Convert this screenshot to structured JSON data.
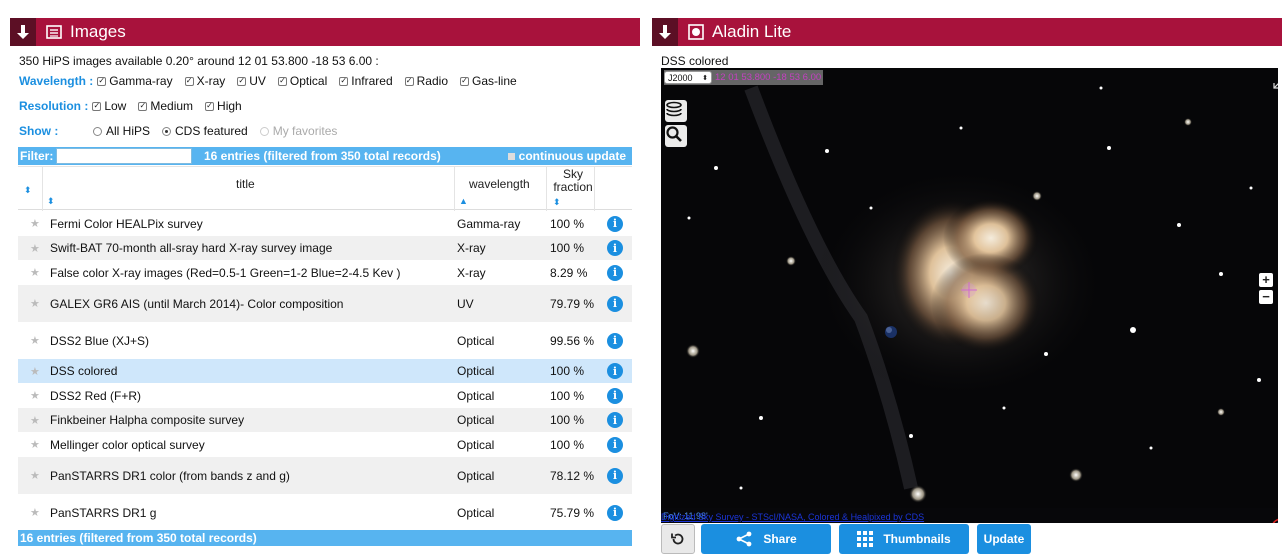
{
  "images_panel": {
    "title": "Images",
    "summary": "350 HiPS images available 0.20° around 12 01 53.800 -18 53 6.00 :",
    "wavelength": {
      "label": "Wavelength :",
      "options": [
        "Gamma-ray",
        "X-ray",
        "UV",
        "Optical",
        "Infrared",
        "Radio",
        "Gas-line"
      ]
    },
    "resolution": {
      "label": "Resolution :",
      "options": [
        "Low",
        "Medium",
        "High"
      ]
    },
    "show": {
      "label": "Show :",
      "options": [
        "All HiPS",
        "CDS featured",
        "My favorites"
      ],
      "selected": "CDS featured"
    },
    "filter": {
      "label": "Filter:",
      "value": "",
      "count_text": "16 entries (filtered from 350 total records)",
      "continuous_update": "continuous update"
    },
    "table": {
      "headers": {
        "title": "title",
        "wavelength": "wavelength",
        "sky_fraction": "Sky fraction"
      },
      "rows": [
        {
          "title": "Fermi Color HEALPix survey",
          "wavelength": "Gamma-ray",
          "fraction": "100 %"
        },
        {
          "title": "Swift-BAT 70-month all-sray hard X-ray survey image",
          "wavelength": "X-ray",
          "fraction": "100 %"
        },
        {
          "title": "False color X-ray images (Red=0.5-1 Green=1-2 Blue=2-4.5 Kev )",
          "wavelength": "X-ray",
          "fraction": "8.29 %"
        },
        {
          "title": "GALEX GR6 AIS (until March 2014)- Color composition",
          "wavelength": "UV",
          "fraction": "79.79 %"
        },
        {
          "title": "DSS2 Blue (XJ+S)",
          "wavelength": "Optical",
          "fraction": "99.56 %"
        },
        {
          "title": "DSS colored",
          "wavelength": "Optical",
          "fraction": "100 %"
        },
        {
          "title": "DSS2 Red (F+R)",
          "wavelength": "Optical",
          "fraction": "100 %"
        },
        {
          "title": "Finkbeiner Halpha composite survey",
          "wavelength": "Optical",
          "fraction": "100 %"
        },
        {
          "title": "Mellinger color optical survey",
          "wavelength": "Optical",
          "fraction": "100 %"
        },
        {
          "title": "PanSTARRS DR1 color (from bands z and g)",
          "wavelength": "Optical",
          "fraction": "78.12 %"
        },
        {
          "title": "PanSTARRS DR1 g",
          "wavelength": "Optical",
          "fraction": "75.79 %"
        }
      ],
      "selected_row": "DSS colored"
    },
    "footer": "16 entries (filtered from 350 total records)"
  },
  "aladin_panel": {
    "title": "Aladin Lite",
    "survey_name": "DSS colored",
    "frame": "J2000",
    "coordinates": "12 01 53.800 -18 53 6.00",
    "fov": "FoV: 11.98'",
    "credit": "Digitized Sky Survey - STScI/NASA, Colored & Healpixed by CDS",
    "buttons": {
      "share": "Share",
      "thumbnails": "Thumbnails",
      "update": "Update"
    }
  }
}
